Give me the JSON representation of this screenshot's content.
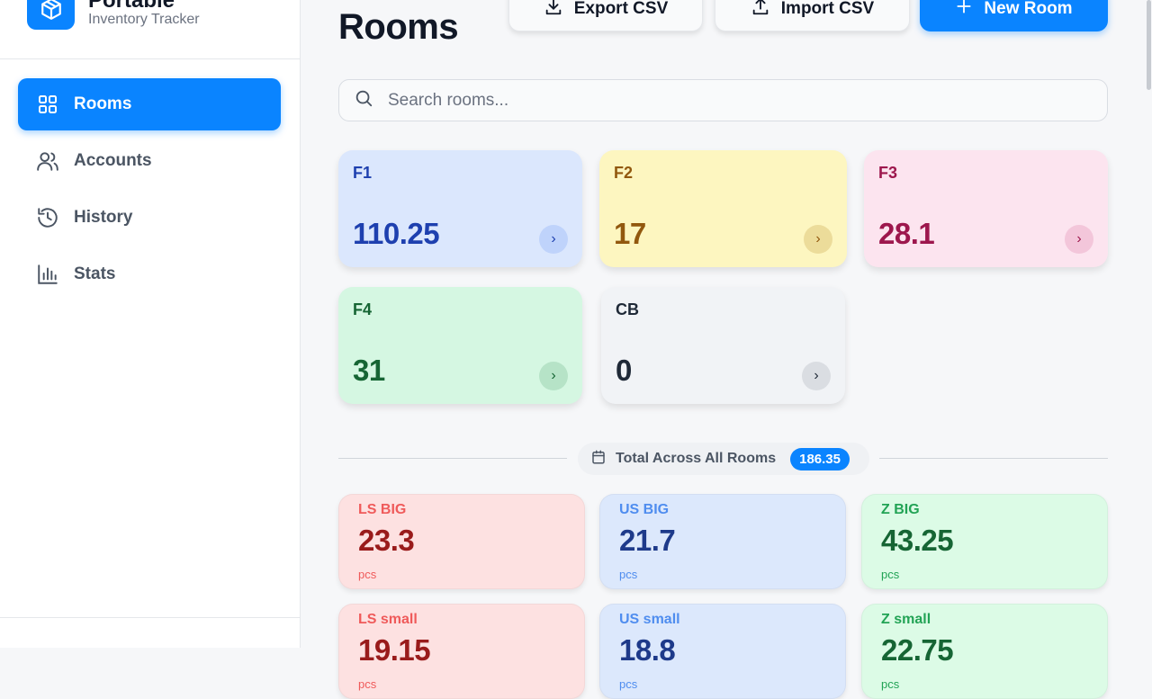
{
  "brand": {
    "name": "Portable",
    "subtitle": "Inventory Tracker"
  },
  "sidebar": {
    "items": [
      {
        "label": "Rooms",
        "icon": "grid-icon",
        "active": true
      },
      {
        "label": "Accounts",
        "icon": "users-icon",
        "active": false
      },
      {
        "label": "History",
        "icon": "history-icon",
        "active": false
      },
      {
        "label": "Stats",
        "icon": "bar-chart-icon",
        "active": false
      }
    ]
  },
  "header": {
    "title": "Rooms",
    "export_label": "Export CSV",
    "import_label": "Import CSV",
    "new_room_label": "New Room"
  },
  "search": {
    "placeholder": "Search rooms..."
  },
  "rooms": [
    {
      "name": "F1",
      "value": "110.25",
      "bg": "#dbe7fd",
      "color": "#1e40af",
      "arrow_bg": "#bfd3fb"
    },
    {
      "name": "F2",
      "value": "17",
      "bg": "#fdf6c0",
      "color": "#92580e",
      "arrow_bg": "#ecdc9a"
    },
    {
      "name": "F3",
      "value": "28.1",
      "bg": "#fce4ef",
      "color": "#9d174d",
      "arrow_bg": "#f3c6da"
    },
    {
      "name": "F4",
      "value": "31",
      "bg": "#d5f7e2",
      "color": "#166534",
      "arrow_bg": "#b6e3c7"
    },
    {
      "name": "CB",
      "value": "0",
      "bg": "#f1f3f6",
      "color": "#1f2937",
      "arrow_bg": "#dadde2"
    }
  ],
  "total": {
    "label": "Total Across All Rooms",
    "value": "186.35"
  },
  "stats": [
    {
      "name": "LS BIG",
      "value": "23.3",
      "unit": "pcs",
      "bg": "#fde1e1",
      "label_color": "#ef5a5a",
      "value_color": "#991b1b"
    },
    {
      "name": "US BIG",
      "value": "21.7",
      "unit": "pcs",
      "bg": "#dce8fc",
      "label_color": "#4f8def",
      "value_color": "#1e3a8a"
    },
    {
      "name": "Z BIG",
      "value": "43.25",
      "unit": "pcs",
      "bg": "#dcfbe6",
      "label_color": "#22a355",
      "value_color": "#166534"
    },
    {
      "name": "LS small",
      "value": "19.15",
      "unit": "pcs",
      "bg": "#fde1e1",
      "label_color": "#ef5a5a",
      "value_color": "#991b1b"
    },
    {
      "name": "US small",
      "value": "18.8",
      "unit": "pcs",
      "bg": "#dce8fc",
      "label_color": "#4f8def",
      "value_color": "#1e3a8a"
    },
    {
      "name": "Z small",
      "value": "22.75",
      "unit": "pcs",
      "bg": "#dcfbe6",
      "label_color": "#22a355",
      "value_color": "#166534"
    }
  ],
  "colors": {
    "accent": "#0a84ff"
  }
}
